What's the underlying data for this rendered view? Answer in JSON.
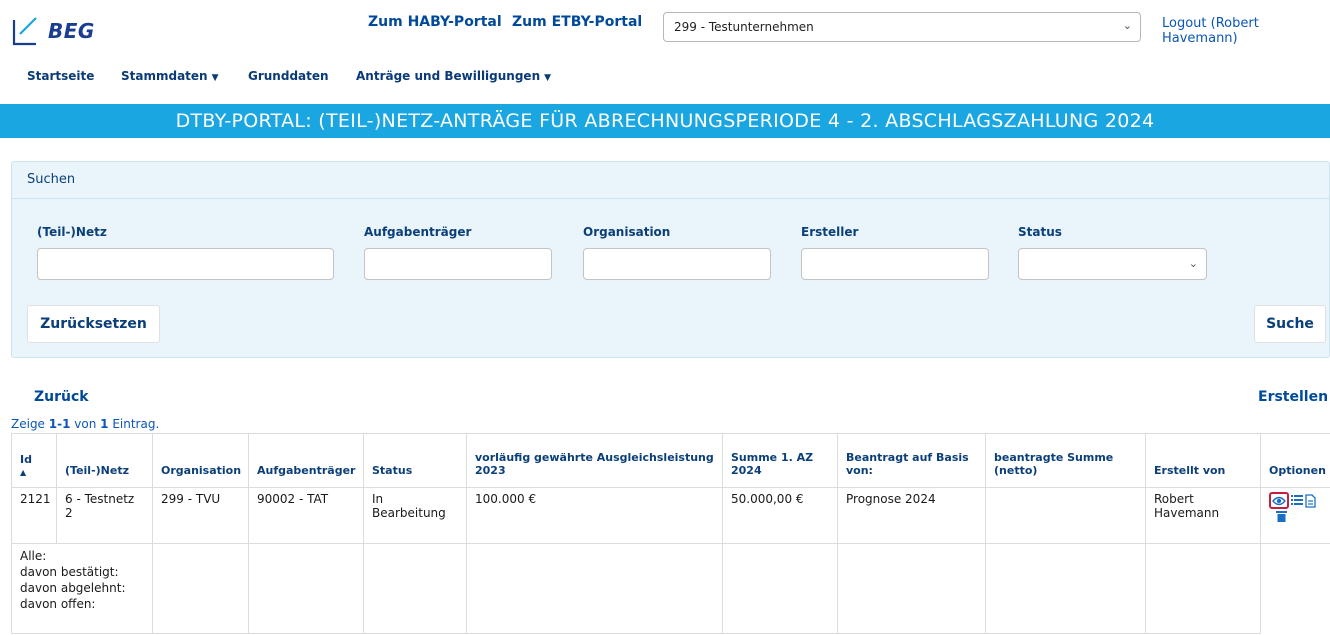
{
  "header": {
    "logo_text": "BEG",
    "portal_links": [
      "Zum HABY-Portal",
      "Zum ETBY-Portal"
    ],
    "company_select": "299 - Testunternehmen",
    "logout": "Logout (Robert Havemann)"
  },
  "nav": {
    "items": [
      {
        "label": "Startseite",
        "dropdown": false
      },
      {
        "label": "Stammdaten",
        "dropdown": true
      },
      {
        "label": "Grunddaten",
        "dropdown": false
      },
      {
        "label": "Anträge und Bewilligungen",
        "dropdown": true
      }
    ]
  },
  "banner": "DTBY-PORTAL: (TEIL-)NETZ-ANTRÄGE FÜR ABRECHNUNGSPERIODE 4 - 2. ABSCHLAGSZAHLUNG 2024",
  "search": {
    "title": "Suchen",
    "fields": [
      {
        "label": "(Teil-)Netz",
        "value": ""
      },
      {
        "label": "Aufgabenträger",
        "value": ""
      },
      {
        "label": "Organisation",
        "value": ""
      },
      {
        "label": "Ersteller",
        "value": ""
      },
      {
        "label": "Status",
        "value": ""
      }
    ],
    "reset_label": "Zurücksetzen",
    "search_label": "Suche"
  },
  "actions": {
    "back": "Zurück",
    "create": "Erstellen"
  },
  "summary": {
    "prefix": "Zeige ",
    "range": "1-1",
    "mid": " von ",
    "total": "1",
    "suffix": " Eintrag."
  },
  "table": {
    "headers": [
      "Id",
      "(Teil-)Netz",
      "Organisation",
      "Aufgabenträger",
      "Status",
      "vorläufig gewährte Ausgleichsleistung 2023",
      "Summe 1. AZ 2024",
      "Beantragt auf Basis von:",
      "beantragte Summe (netto)",
      "Erstellt von",
      "Optionen"
    ],
    "rows": [
      [
        "2121",
        "6 - Testnetz 2",
        "299 - TVU",
        "90002 - TAT",
        "In Bearbeitung",
        "100.000 €",
        "50.000,00 €",
        "Prognose 2024",
        "",
        "Robert Havemann"
      ]
    ],
    "totals_labels": [
      "Alle:",
      "davon bestätigt:",
      "davon abgelehnt:",
      "davon offen:"
    ]
  },
  "colors": {
    "banner": "#1aa6e0",
    "panel": "#eaf5fb",
    "link": "#0b3f7a",
    "highlight": "#c4203b"
  }
}
